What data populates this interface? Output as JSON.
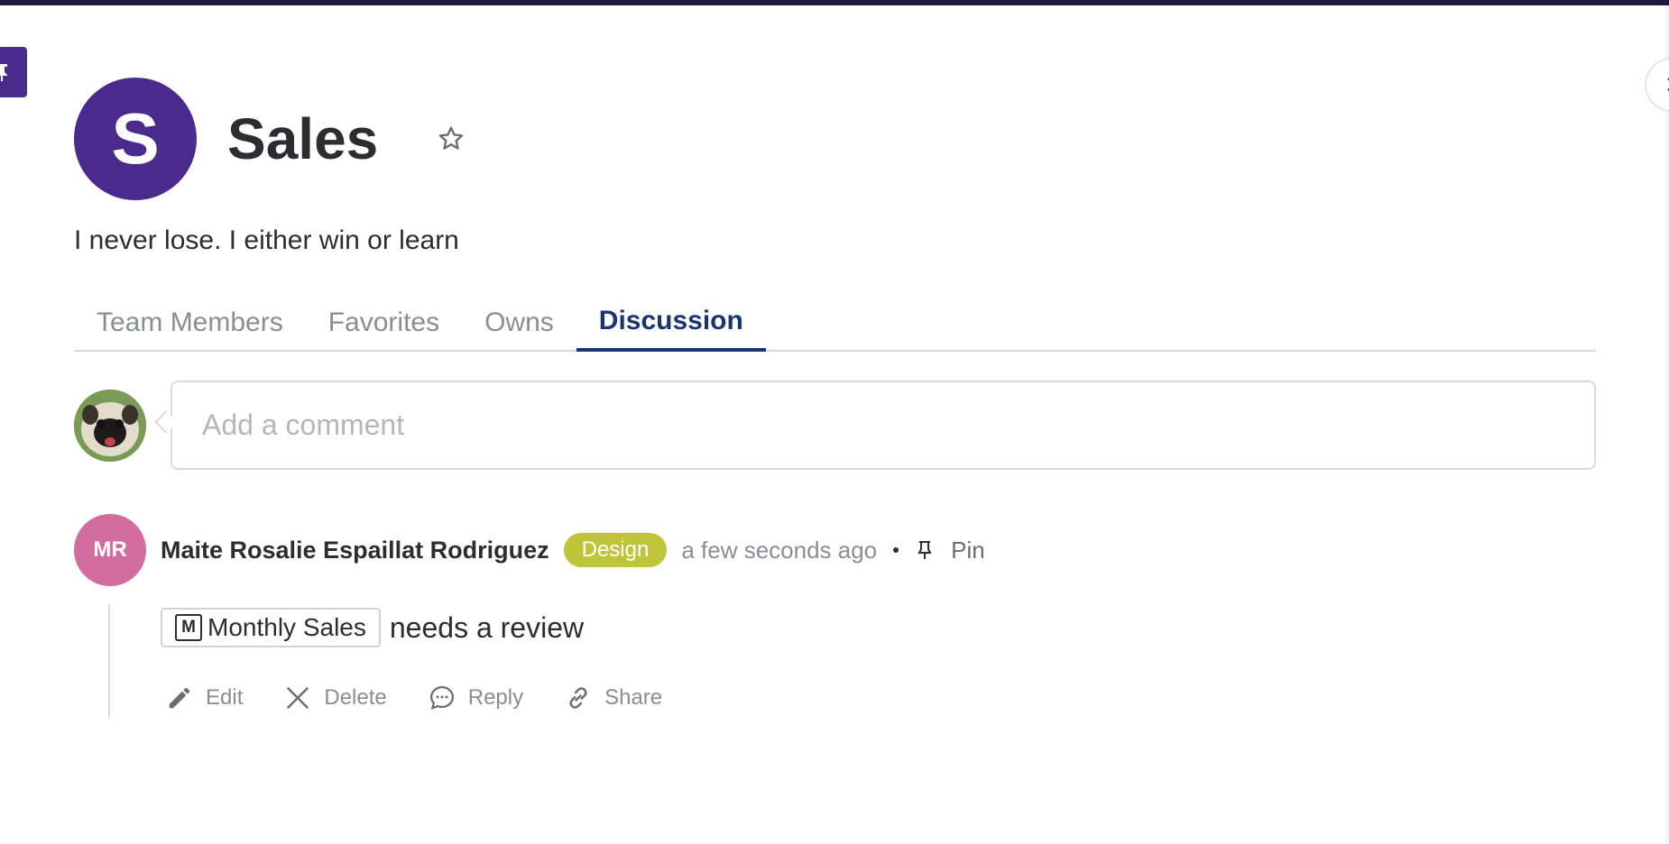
{
  "team": {
    "avatar_letter": "S",
    "name": "Sales",
    "tagline": "I never lose. I either win or learn",
    "accent_color": "#4b2a8e"
  },
  "tabs": [
    {
      "label": "Team Members",
      "active": false
    },
    {
      "label": "Favorites",
      "active": false
    },
    {
      "label": "Owns",
      "active": false
    },
    {
      "label": "Discussion",
      "active": true
    }
  ],
  "comment_input": {
    "placeholder": "Add a comment"
  },
  "post": {
    "author_initials": "MR",
    "author_name": "Maite Rosalie Espaillat Rodriguez",
    "tag": "Design",
    "tag_color": "#c0c43a",
    "time": "a few seconds ago",
    "pin_label": "Pin",
    "mention": {
      "icon_letter": "M",
      "label": "Monthly Sales"
    },
    "text": "needs a review",
    "actions": {
      "edit": "Edit",
      "delete": "Delete",
      "reply": "Reply",
      "share": "Share"
    }
  },
  "icons": {
    "pin_tab": "pin-icon",
    "close": "close-icon",
    "favorite": "star-icon",
    "edit": "pencil-icon",
    "delete": "x-icon",
    "reply": "speech-bubble-icon",
    "share": "link-icon"
  }
}
